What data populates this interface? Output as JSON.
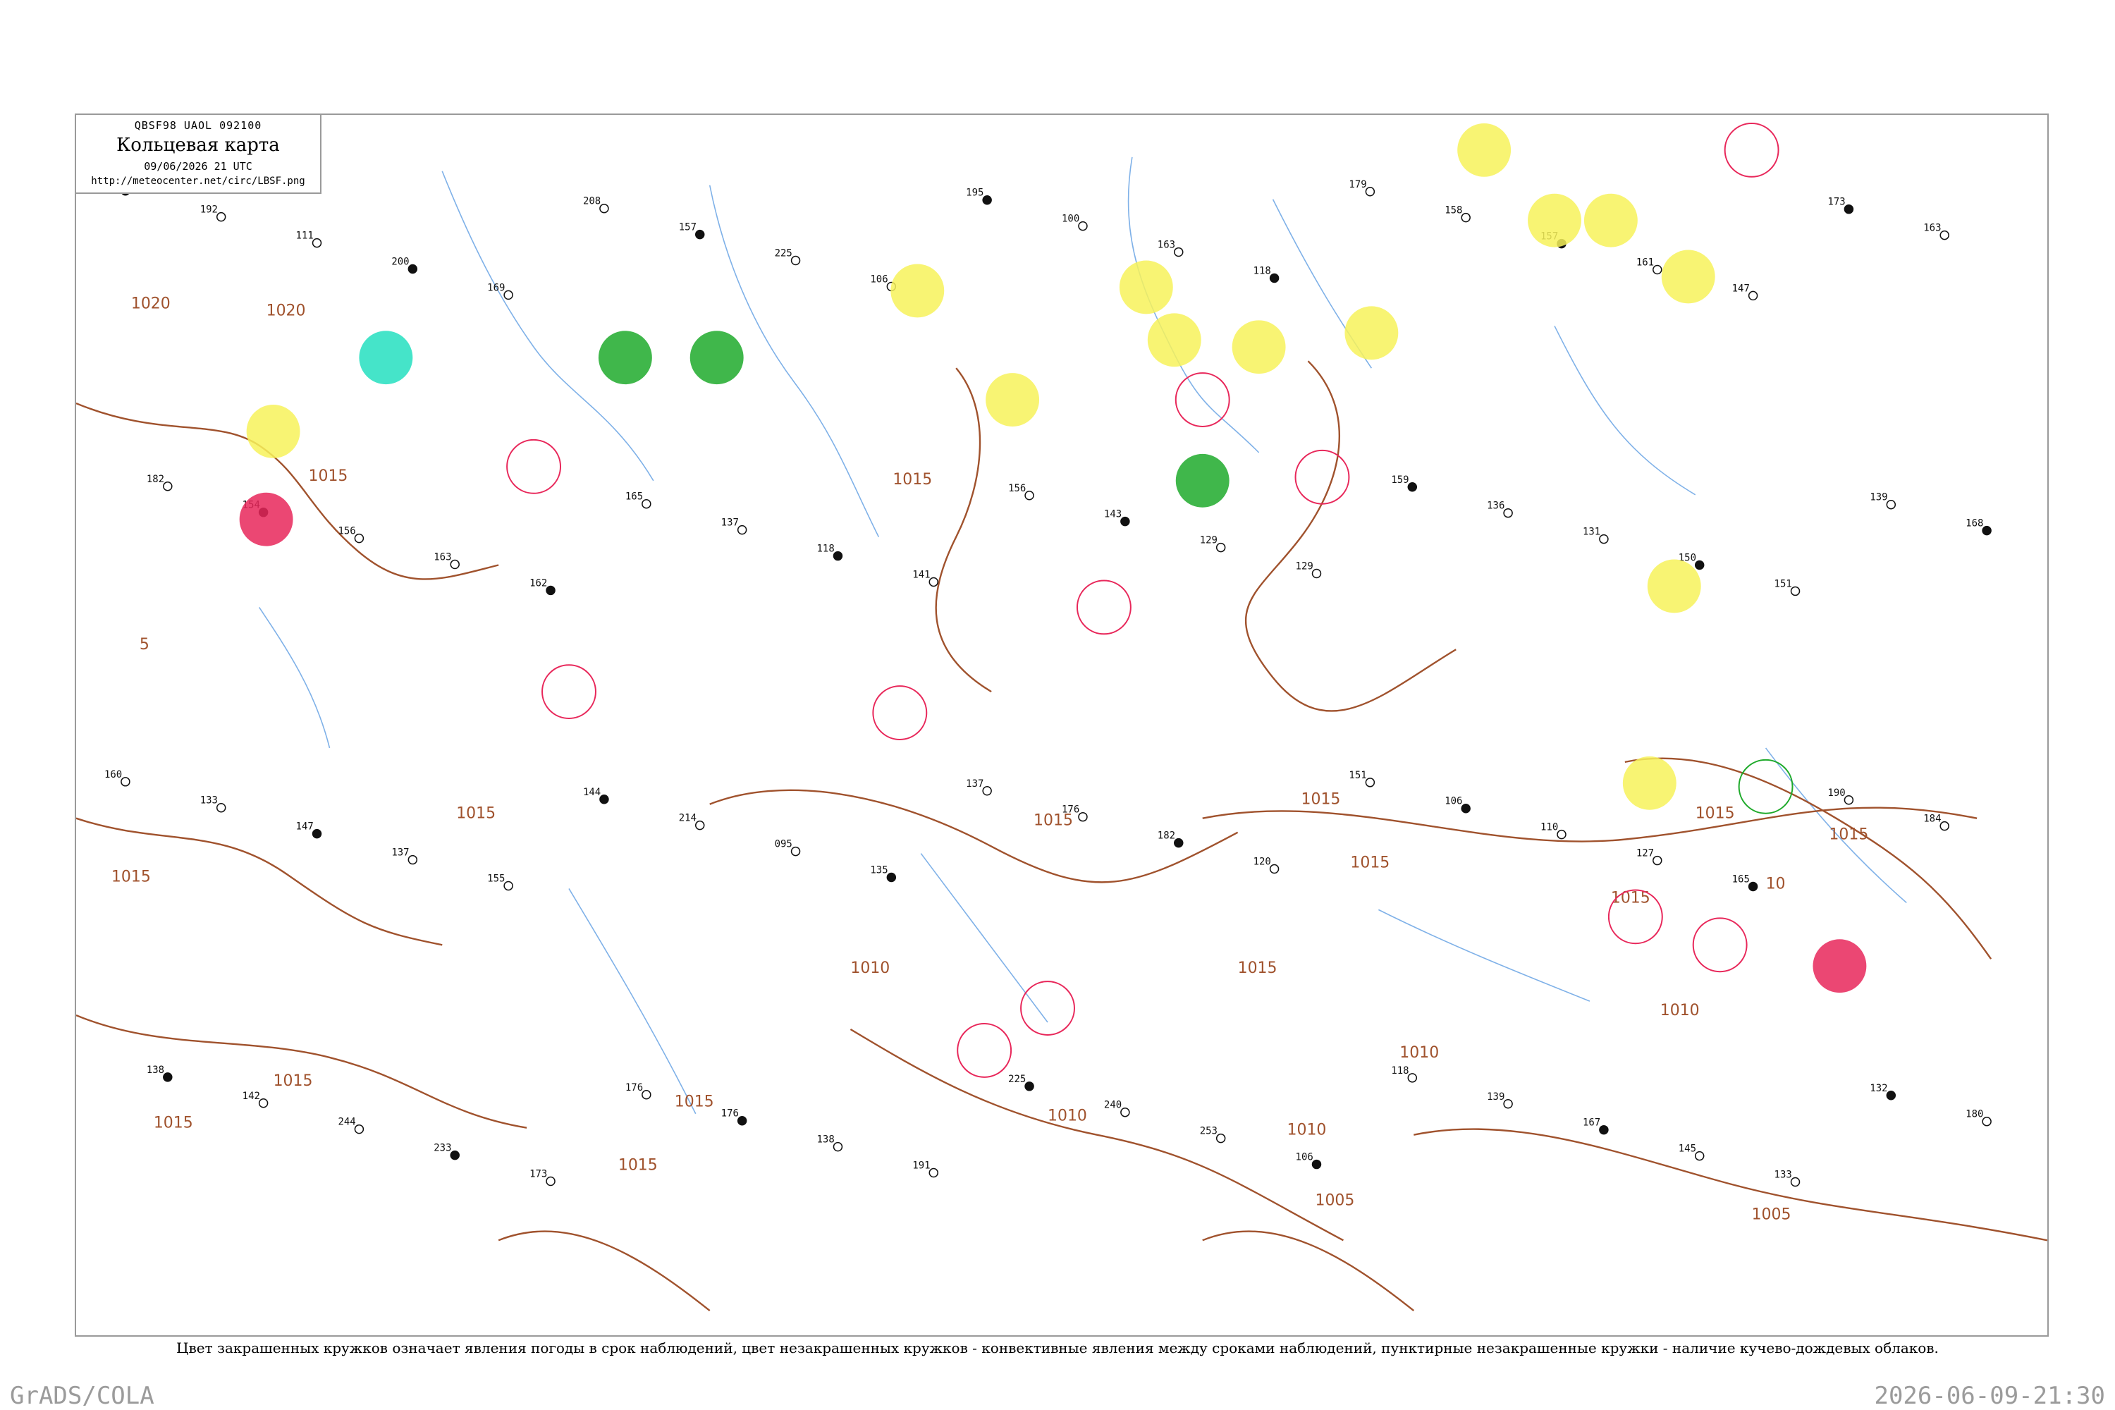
{
  "header": {
    "codes": "QBSF98  UAOL  092100",
    "title": "Кольцевая карта",
    "datetime": "09/06/2026 21 UTC",
    "url": "http://meteocenter.net/circ/LBSF.png"
  },
  "legend_note": "Цвет закрашенных кружков означает явления погоды в срок наблюдений, цвет незакрашенных кружков - конвективные явления между сроками наблюдений, пунктирные незакрашенные кружки - наличие кучево-дождевых облаков.",
  "footer": {
    "left": "GrADS/COLA",
    "right": "2026-06-09-21:30"
  },
  "colors": {
    "isobar": "#a0522d",
    "river": "#7fb1e8",
    "rain": "#1faa2b",
    "shower": "#25dfc0",
    "fog": "#f7f25a",
    "thunderstorm": "#e8275a"
  },
  "isobar_labels": [
    "1020",
    "1020",
    "1015",
    "1015",
    "1015",
    "1015",
    "1015",
    "1015",
    "1015",
    "1015",
    "1015",
    "1010",
    "1010",
    "1010",
    "1010",
    "1005",
    "1005",
    "1015",
    "1015",
    "1015",
    "1015",
    "5",
    "1015",
    "1015",
    "10",
    "1010"
  ],
  "station_samples": [
    "143",
    "192",
    "111",
    "200",
    "169",
    "208",
    "157",
    "225",
    "106",
    "195",
    "100",
    "163",
    "118",
    "179",
    "158",
    "157",
    "161",
    "147",
    "173",
    "163",
    "182",
    "154",
    "156",
    "163",
    "162",
    "165",
    "137",
    "118",
    "141",
    "156",
    "143",
    "129",
    "129",
    "159",
    "136",
    "131",
    "150",
    "151",
    "139",
    "168",
    "160",
    "133",
    "147",
    "137",
    "155",
    "144",
    "214",
    "095",
    "135",
    "137",
    "176",
    "182",
    "120",
    "151",
    "106",
    "110",
    "127",
    "165",
    "190",
    "184",
    "138",
    "142",
    "244",
    "233",
    "173",
    "176",
    "176",
    "138",
    "191",
    "225",
    "240",
    "253",
    "106",
    "118",
    "139",
    "167",
    "145",
    "133",
    "132",
    "180"
  ]
}
